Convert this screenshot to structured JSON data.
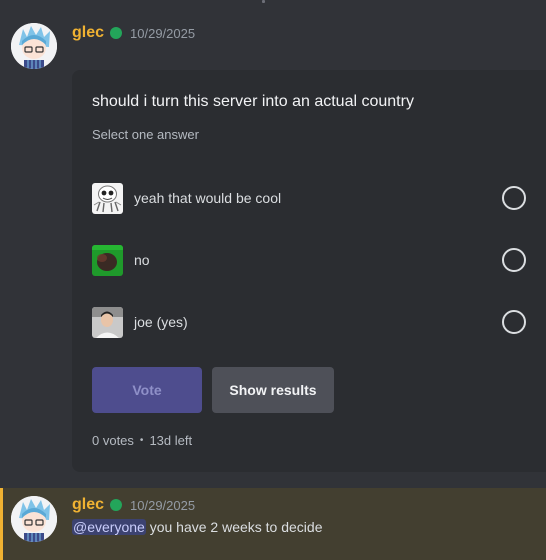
{
  "messages": [
    {
      "username": "glec",
      "timestamp": "10/29/2025",
      "poll": {
        "question": "should i turn this server into an actual country",
        "subtitle": "Select one answer",
        "answers": [
          {
            "label": "yeah that would be cool"
          },
          {
            "label": "no"
          },
          {
            "label": "joe (yes)"
          }
        ],
        "vote_label": "Vote",
        "results_label": "Show results",
        "votes_text": "0 votes",
        "time_left": "13d left"
      }
    },
    {
      "username": "glec",
      "timestamp": "10/29/2025",
      "mention": "@everyone",
      "text": " you have 2 weeks to decide"
    }
  ],
  "colors": {
    "background": "#313338",
    "poll_background": "#2b2d31",
    "username": "#f0b232",
    "online": "#23a55a",
    "highlight": "#433f30",
    "vote_button": "#4e4d8e",
    "results_button": "#4e5058"
  }
}
